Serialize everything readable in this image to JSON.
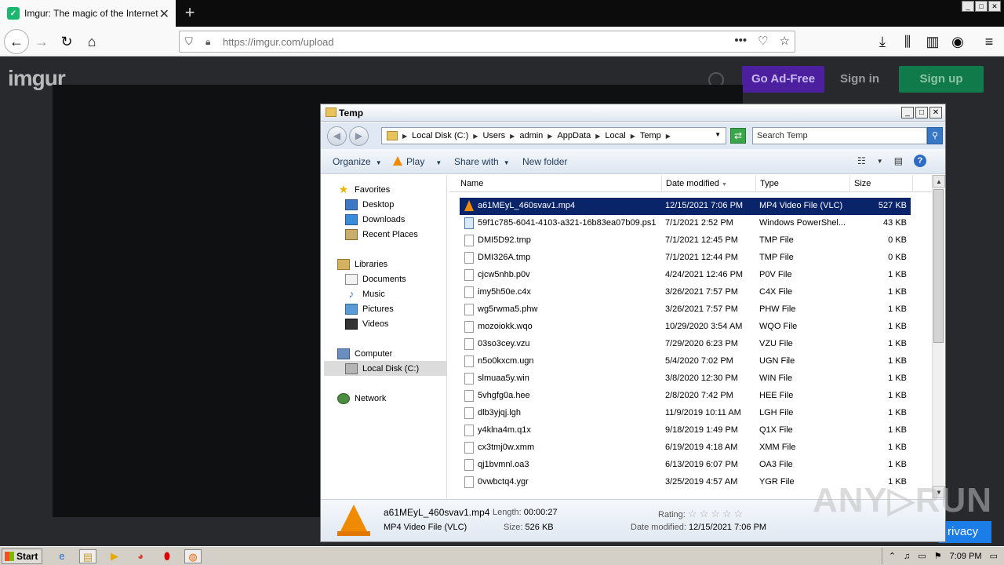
{
  "browser": {
    "tab_title": "Imgur: The magic of the Internet",
    "url_domain": "https://imgur.com",
    "url_path": "/upload",
    "win_min": "_",
    "win_max": "□",
    "win_close": "✕"
  },
  "imgur": {
    "logo": "imgur",
    "go_ad_free": "Go Ad-Free",
    "sign_in": "Sign in",
    "sign_up": "Sign up",
    "privacy": "rivacy"
  },
  "explorer": {
    "title": "Temp",
    "breadcrumbs": [
      "Local Disk (C:)",
      "Users",
      "admin",
      "AppData",
      "Local",
      "Temp"
    ],
    "search_placeholder": "Search Temp",
    "toolbar": {
      "organize": "Organize",
      "play": "Play",
      "share_with": "Share with",
      "new_folder": "New folder"
    },
    "nav": {
      "favorites": "Favorites",
      "desktop": "Desktop",
      "downloads": "Downloads",
      "recent_places": "Recent Places",
      "libraries": "Libraries",
      "documents": "Documents",
      "music": "Music",
      "pictures": "Pictures",
      "videos": "Videos",
      "computer": "Computer",
      "local_disk": "Local Disk (C:)",
      "network": "Network"
    },
    "columns": {
      "name": "Name",
      "date_modified": "Date modified",
      "type": "Type",
      "size": "Size"
    },
    "files": [
      {
        "name": "a61MEyL_460svav1.mp4",
        "date": "12/15/2021 7:06 PM",
        "type": "MP4 Video File (VLC)",
        "size": "527 KB"
      },
      {
        "name": "59f1c785-6041-4103-a321-16b83ea07b09.ps1",
        "date": "7/1/2021 2:52 PM",
        "type": "Windows PowerShel...",
        "size": "43 KB"
      },
      {
        "name": "DMI5D92.tmp",
        "date": "7/1/2021 12:45 PM",
        "type": "TMP File",
        "size": "0 KB"
      },
      {
        "name": "DMI326A.tmp",
        "date": "7/1/2021 12:44 PM",
        "type": "TMP File",
        "size": "0 KB"
      },
      {
        "name": "cjcw5nhb.p0v",
        "date": "4/24/2021 12:46 PM",
        "type": "P0V File",
        "size": "1 KB"
      },
      {
        "name": "imy5h50e.c4x",
        "date": "3/26/2021 7:57 PM",
        "type": "C4X File",
        "size": "1 KB"
      },
      {
        "name": "wg5rwma5.phw",
        "date": "3/26/2021 7:57 PM",
        "type": "PHW File",
        "size": "1 KB"
      },
      {
        "name": "mozoiokk.wqo",
        "date": "10/29/2020 3:54 AM",
        "type": "WQO File",
        "size": "1 KB"
      },
      {
        "name": "03so3cey.vzu",
        "date": "7/29/2020 6:23 PM",
        "type": "VZU File",
        "size": "1 KB"
      },
      {
        "name": "n5o0kxcm.ugn",
        "date": "5/4/2020 7:02 PM",
        "type": "UGN File",
        "size": "1 KB"
      },
      {
        "name": "slmuaa5y.win",
        "date": "3/8/2020 12:30 PM",
        "type": "WIN File",
        "size": "1 KB"
      },
      {
        "name": "5vhgfg0a.hee",
        "date": "2/8/2020 7:42 PM",
        "type": "HEE File",
        "size": "1 KB"
      },
      {
        "name": "dlb3yjqj.lgh",
        "date": "11/9/2019 10:11 AM",
        "type": "LGH File",
        "size": "1 KB"
      },
      {
        "name": "y4klna4m.q1x",
        "date": "9/18/2019 1:49 PM",
        "type": "Q1X File",
        "size": "1 KB"
      },
      {
        "name": "cx3tmj0w.xmm",
        "date": "6/19/2019 4:18 AM",
        "type": "XMM File",
        "size": "1 KB"
      },
      {
        "name": "qj1bvmnl.oa3",
        "date": "6/13/2019 6:07 PM",
        "type": "OA3 File",
        "size": "1 KB"
      },
      {
        "name": "0vwbctq4.ygr",
        "date": "3/25/2019 4:57 AM",
        "type": "YGR File",
        "size": "1 KB"
      }
    ],
    "details": {
      "filename": "a61MEyL_460svav1.mp4",
      "filetype": "MP4 Video File (VLC)",
      "length_label": "Length:",
      "length": "00:00:27",
      "size_label": "Size:",
      "size": "526 KB",
      "rating_label": "Rating:",
      "rating_stars": "☆☆☆☆☆",
      "date_label": "Date modified:",
      "date": "12/15/2021 7:06 PM"
    }
  },
  "watermark": "ANY▷RUN",
  "taskbar": {
    "start": "Start",
    "clock": "7:09 PM"
  }
}
